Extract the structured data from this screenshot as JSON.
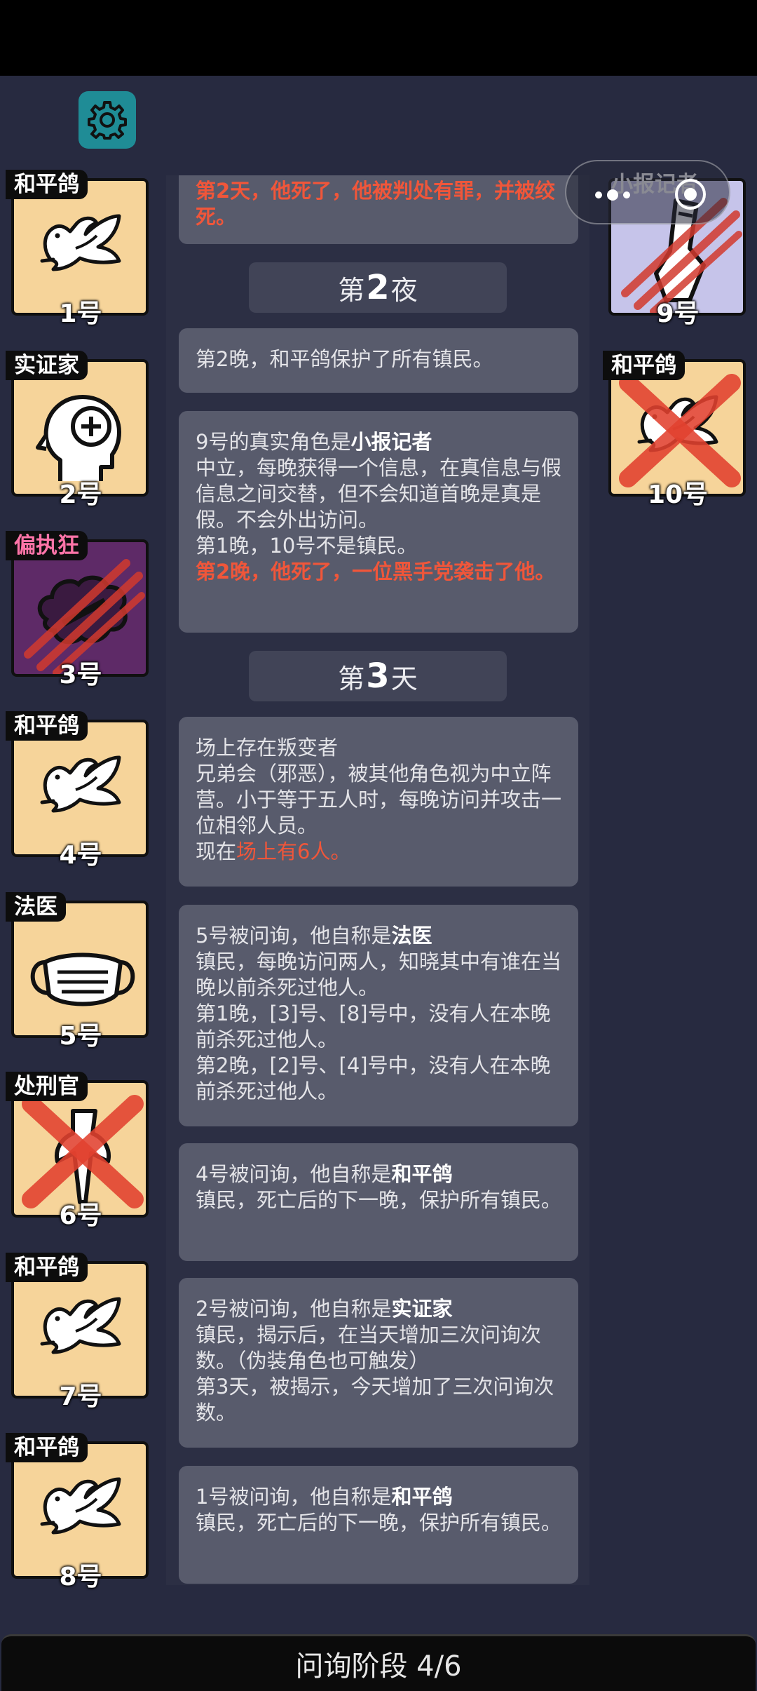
{
  "phase_label": "问询阶段 4/6",
  "feed": {
    "top_card": "第2天，他死了，他被判处有罪，并被绞死。",
    "night2": {
      "prefix": "第",
      "num": "2",
      "suffix": "夜"
    },
    "card_night2": "第2晚，和平鸽保护了所有镇民。",
    "card_reporter": {
      "lead": "9号的真实角色是",
      "role": "小报记者",
      "desc": "中立，每晚获得一个信息，在真信息与假信息之间交替，但不会知道首晚是真是假。不会外出访问。",
      "line": "第1晚，10号不是镇民。",
      "death": "第2晚，他死了，一位黑手党袭击了他。"
    },
    "day3": {
      "prefix": "第",
      "num": "3",
      "suffix": "天"
    },
    "card_traitor": {
      "title": "场上存在叛变者",
      "desc": "兄弟会（邪恶），被其他角色视为中立阵营。小于等于五人时，每晚访问并攻击一位相邻人员。",
      "now": "现在",
      "count": "场上有6人。"
    },
    "card_medic": {
      "lead": "5号被问询，他自称是",
      "role": "法医",
      "desc": "镇民，每晚访问两人，知晓其中有谁在当晚以前杀死过他人。",
      "line1": "第1晚，[3]号、[8]号中，没有人在本晚前杀死过他人。",
      "line2": "第2晚，[2]号、[4]号中，没有人在本晚前杀死过他人。"
    },
    "card_dove4": {
      "lead": "4号被问询，他自称是",
      "role": "和平鸽",
      "desc": "镇民，死亡后的下一晚，保护所有镇民。"
    },
    "card_emp": {
      "lead": "2号被问询，他自称是",
      "role": "实证家",
      "desc": "镇民，揭示后，在当天增加三次问询次数。（伪装角色也可触发）",
      "line": "第3天，被揭示，今天增加了三次问询次数。"
    },
    "card_dove1": {
      "lead": "1号被问询，他自称是",
      "role": "和平鸽",
      "desc": "镇民，死亡后的下一晚，保护所有镇民。"
    }
  },
  "players_left": [
    {
      "role": "和平鸽",
      "num": "1号",
      "icon": "dove-icon"
    },
    {
      "role": "实证家",
      "num": "2号",
      "icon": "head-plus-icon"
    },
    {
      "role": "偏执狂",
      "num": "3号",
      "icon": "paranoid-icon"
    },
    {
      "role": "和平鸽",
      "num": "4号",
      "icon": "dove-icon"
    },
    {
      "role": "法医",
      "num": "5号",
      "icon": "mask-icon"
    },
    {
      "role": "处刑官",
      "num": "6号",
      "icon": "axe-icon"
    },
    {
      "role": "和平鸽",
      "num": "7号",
      "icon": "dove-icon"
    },
    {
      "role": "和平鸽",
      "num": "8号",
      "icon": "dove-icon"
    }
  ],
  "players_right": [
    {
      "role": "小报记者",
      "num": "9号",
      "icon": "reporter-icon"
    },
    {
      "role": "和平鸽",
      "num": "10号",
      "icon": "dove-icon"
    }
  ],
  "colors": {
    "accent_red": "#f0563a",
    "card_bg": "#585b6c",
    "role_card_bg": "#f6d49a"
  }
}
